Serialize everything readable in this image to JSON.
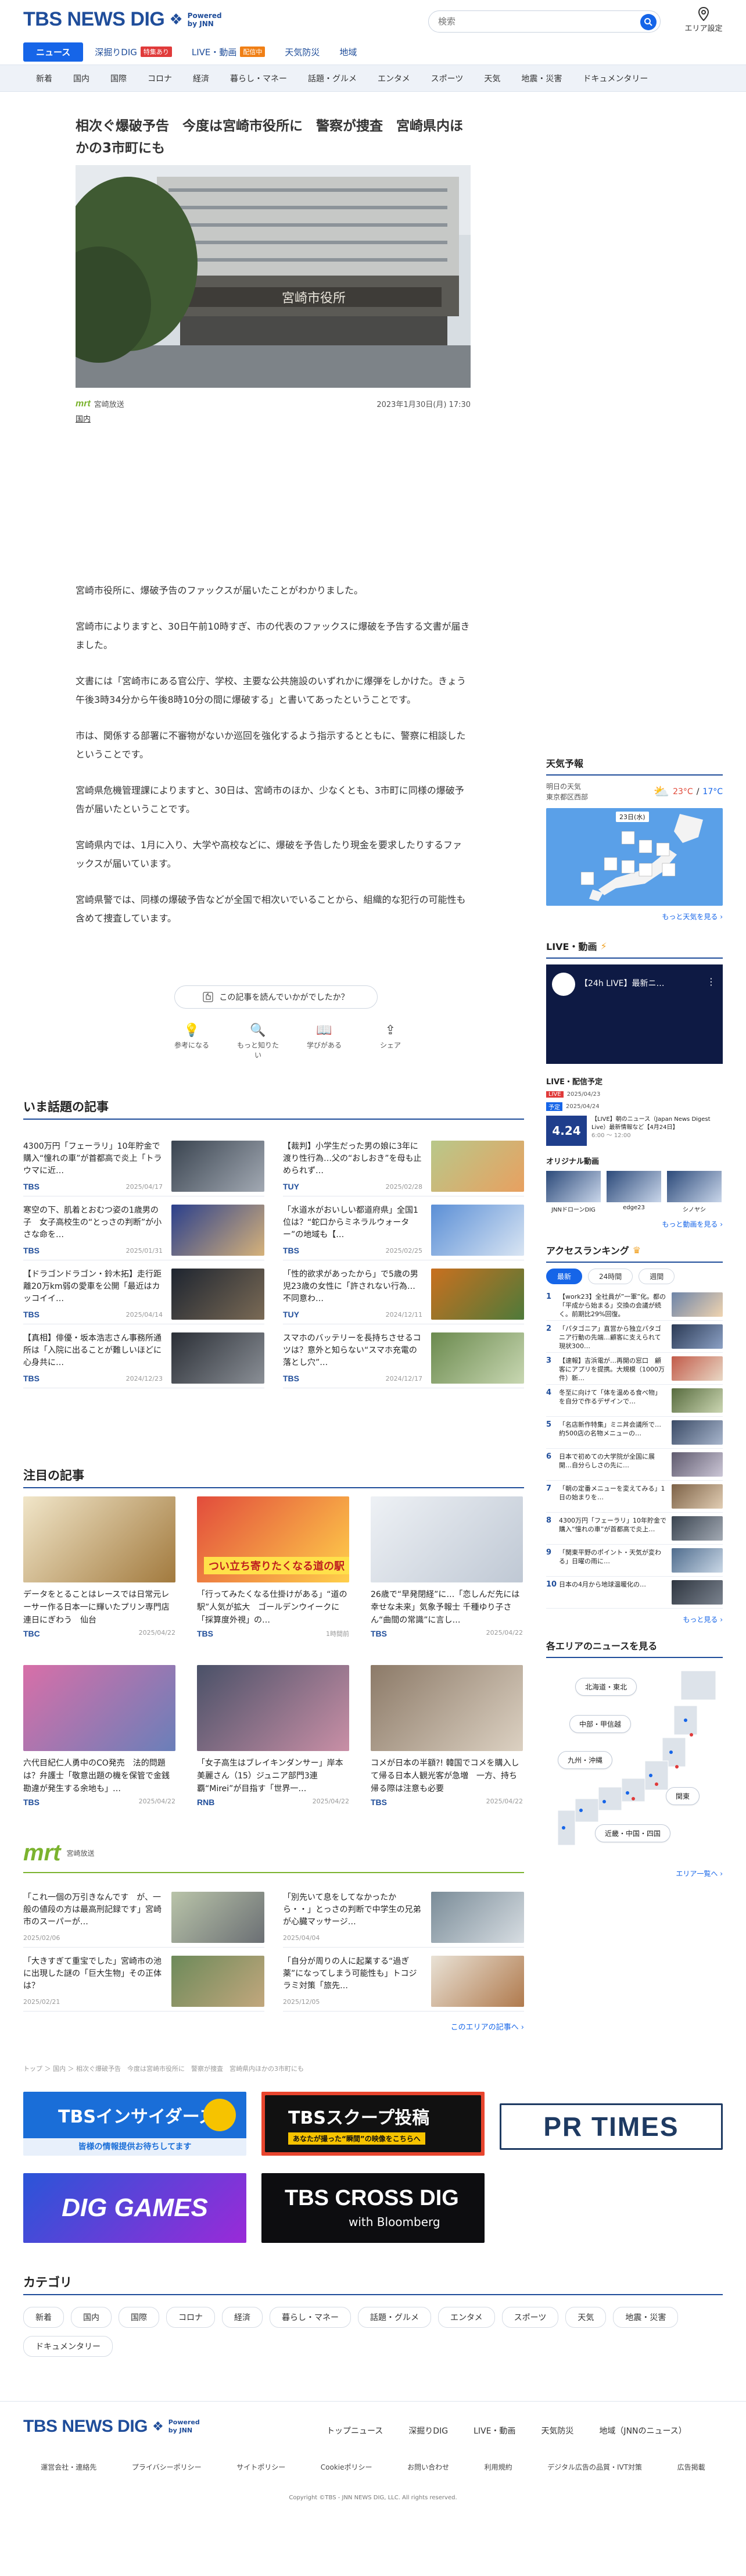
{
  "header": {
    "logo_main": "TBS NEWS DIG",
    "logo_sub_1": "Powered",
    "logo_sub_2": "by JNN",
    "search_placeholder": "検索",
    "area_setting": "エリア設定",
    "nav": [
      {
        "label": "ニュース"
      },
      {
        "label": "深掘りDIG",
        "badge": "特集あり",
        "badge_color": "#e03a3a"
      },
      {
        "label": "LIVE・動画",
        "badge": "配信中",
        "badge_color": "#f07f15"
      },
      {
        "label": "天気防災"
      },
      {
        "label": "地域"
      }
    ],
    "subnav": [
      "新着",
      "国内",
      "国際",
      "コロナ",
      "経済",
      "暮らし・マネー",
      "話題・グルメ",
      "エンタメ",
      "スポーツ",
      "天気",
      "地震・災害",
      "ドキュメンタリー"
    ]
  },
  "article": {
    "title": "相次ぐ爆破予告　今度は宮崎市役所に　警察が捜査　宮崎県内ほかの3市町にも",
    "hero_sign": "宮崎市役所",
    "source": "宮崎放送",
    "source_logo": "mrt",
    "datetime": "2023年1月30日(月) 17:30",
    "category": "国内",
    "paragraphs": [
      "宮崎市役所に、爆破予告のファックスが届いたことがわかりました。",
      "宮崎市によりますと、30日午前10時すぎ、市の代表のファックスに爆破を予告する文書が届きました。",
      "文書には「宮崎市にある官公庁、学校、主要な公共施設のいずれかに爆弾をしかけた。きょう午後3時34分から午後8時10分の間に爆破する」と書いてあったということです。",
      "市は、関係する部署に不審物がないか巡回を強化するよう指示するとともに、警察に相談したということです。",
      "宮崎県危機管理課によりますと、30日は、宮崎市のほか、少なくとも、3市町に同様の爆破予告が届いたということです。",
      "宮崎県内では、1月に入り、大学や高校などに、爆破を予告したり現金を要求したりするファックスが届いています。",
      "宮崎県警では、同様の爆破予告などが全国で相次いでいることから、組織的な犯行の可能性も含めて捜査しています。"
    ],
    "feedback": "この記事を読んでいかがでしたか？",
    "reactions": [
      "参考になる",
      "もっと知りたい",
      "学びがある",
      "シェア"
    ]
  },
  "topics": {
    "title": "いま話題の記事",
    "items": [
      {
        "text": "4300万円「フェーラリ」10年貯金で購入“憧れの車”が首都高で炎上「トラウマに近…",
        "source": "TBS",
        "date": "2025/04/17",
        "c1": "#3a4450",
        "c2": "#a2a9b3"
      },
      {
        "text": "【裁判】小学生だった男の娘に3年に渡り性行為…父の“おしおき”を母も止められず…",
        "source": "TUY",
        "date": "2025/02/28",
        "c1": "#b8c88a",
        "c2": "#e8a060"
      },
      {
        "text": "寒空の下、肌着とおむつ姿の1歳男の子　女子高校生の“とっさの判断”が小さな命を…",
        "source": "TBS",
        "date": "2025/01/31",
        "c1": "#2a3f8c",
        "c2": "#d6b27a"
      },
      {
        "text": "「水道水がおいしい都道府県」全国1位は？“蛇口からミネラルウォーター”の地域も【…",
        "source": "TBS",
        "date": "2025/02/25",
        "c1": "#5b8fd6",
        "c2": "#d9e5f3"
      },
      {
        "text": "【ドラゴンドラゴン・鈴木拓】走行距離20万km弱の愛車を公開「最近はカッコイイ…",
        "source": "TBS",
        "date": "2025/04/14",
        "c1": "#1e2530",
        "c2": "#7a6a55"
      },
      {
        "text": "「性的欲求があったから」で5歳の男児23歳の女性に「許されない行為…不同意わ…",
        "source": "TUY",
        "date": "2024/12/11",
        "c1": "#c9701f",
        "c2": "#4e7a3a"
      },
      {
        "text": "【真相】俳優・坂本浩志さん事務所通所は「入院に出ることが難しいほどに心身共に…",
        "source": "TBS",
        "date": "2024/12/23",
        "c1": "#2b2f36",
        "c2": "#8a8f96"
      },
      {
        "text": "スマホのバッテリーを長持ちさせるコツは？意外と知らない“スマホ充電の落とし穴”…",
        "source": "TBS",
        "date": "2024/12/17",
        "c1": "#6b8a4e",
        "c2": "#c8d7b2"
      }
    ]
  },
  "attention": {
    "title": "注目の記事",
    "items": [
      {
        "text": "データをとることはレースでは日常元レーサー作る日本一に輝いたプリン専門店　連日にぎわう　仙台",
        "source": "TBC",
        "date": "2025/04/22",
        "c1": "#f1e6c9",
        "c2": "#a27a3e"
      },
      {
        "text": "「行ってみたくなる仕掛けがある」“道の駅”人気が拡大　ゴールデンウイークに「採算度外視」の…",
        "source": "TBS",
        "date": "1時間前",
        "c1": "#e24c3c",
        "c2": "#ffd04a",
        "overlay": "つい立ち寄りたくなる道の駅"
      },
      {
        "text": "26歳で“早発閉経”に…「恋しんだ先には幸せな未来」気象予報士 千種ゆり子さん“曲間の常識”に言し…",
        "source": "TBS",
        "date": "2025/04/22",
        "c1": "#eef1f5",
        "c2": "#bfc8d4"
      },
      {
        "text": "六代目紀仁人勇中のCO発売　法的問題は？弁護士「敬意出題の機を保管で金銭勘違が発生する余地も」…",
        "source": "TBS",
        "date": "2025/04/22",
        "c1": "#d86fa8",
        "c2": "#6a7fb9"
      },
      {
        "text": "「女子高生はブレイキンダンサー」岸本美麗さん（15）ジュニア部門3連覇“Mirei”が目指す「世界一…",
        "source": "RNB",
        "date": "2025/04/22",
        "c1": "#4a5168",
        "c2": "#c98fa6"
      },
      {
        "text": "コメが日本の半額?! 韓国でコメを購入して帰る日本人観光客が急増　一方、持ち帰る際は注意も必要",
        "source": "TBS",
        "date": "2025/04/22",
        "c1": "#8c7a68",
        "c2": "#dcd1c2"
      }
    ]
  },
  "local": {
    "logo": "mrt",
    "name": "宮崎放送",
    "items": [
      {
        "text": "「これ一個の万引きなんです　が、一般の値段の方は最高刑記録です」宮崎市のスーパーが…",
        "date": "2025/02/06",
        "c1": "#b9c4a9",
        "c2": "#6b6f74"
      },
      {
        "text": "「別先いて息をしてなかったから・・」とっさの判断で中学生の兄弟が心臓マッサージ…",
        "date": "2025/04/04",
        "c1": "#7a8c98",
        "c2": "#d7dde2"
      },
      {
        "text": "「大きすぎて重宝でした」宮崎市の池に出現した謎の「巨大生物」その正体は？",
        "date": "2025/02/21",
        "c1": "#6d8a5a",
        "c2": "#c2a77d"
      },
      {
        "text": "「自分が周りの人に起業する“過ぎ薬”になってしまう可能性も」トコジラミ対策「旅先…",
        "date": "2025/12/05",
        "c1": "#e9e2d6",
        "c2": "#b07a4d"
      }
    ],
    "more": "このエリアの記事へ ›"
  },
  "breadcrumb": "トップ ＞ 国内 ＞ 相次ぐ爆破予告　今度は宮崎市役所に　警察が捜査　宮崎県内ほかの3市町にも",
  "banners": {
    "insider_main": "TBSインサイダーズ",
    "insider_sub": "皆様の情報提供お待ちしてます",
    "scoop_main": "TBSスクープ投稿",
    "scoop_sub": "あなたが撮った“瞬間”の映像をこちらへ",
    "prtimes": "PR TIMES",
    "digagames": "DIG GAMES",
    "crossdig_main": "TBS CROSS DIG",
    "crossdig_sub": "with Bloomberg"
  },
  "categories": {
    "title": "カテゴリ",
    "items": [
      "新着",
      "国内",
      "国際",
      "コロナ",
      "経済",
      "暮らし・マネー",
      "話題・グルメ",
      "エンタメ",
      "スポーツ",
      "天気",
      "地震・災害",
      "ドキュメンタリー"
    ]
  },
  "sidebar": {
    "weather": {
      "title": "天気予報",
      "label": "明日の天気",
      "region": "東京都区西部",
      "hi": "23°C",
      "lo": "17°C",
      "day_label": "23日(水)",
      "more": "もっと天気を見る ›"
    },
    "live": {
      "title": "LIVE・動画",
      "video_title": "【24h LIVE】最新ニ…",
      "schedule_title": "LIVE・配信予定",
      "sched_date": "2025/04/23",
      "sched_date2": "2025/04/24",
      "sched_badge": "4.24",
      "sched_text": "【LIVE】朝のニュース（Japan News Digest Live）最新情報など【4月24日】",
      "sched_time": "6:00 ～ 12:00",
      "original_title": "オリジナル動画",
      "originals": [
        "JNNドローンDIG",
        "edge23",
        "シノヤシ"
      ],
      "more": "もっと動画を見る ›"
    },
    "ranking": {
      "title": "アクセスランキング",
      "tabs": [
        "最新",
        "24時間",
        "週間"
      ],
      "items": [
        {
          "n": "1",
          "text": "【work23】全社員が”一軍”化。都の「平成から始まる」交換の会議が続く。前期比29%回復。",
          "c1": "#6d84a8",
          "c2": "#f0d4b0"
        },
        {
          "n": "2",
          "text": "「パタゴニア」直営から独立パタゴニア行動の先端…顧客に支えられて現状300…",
          "c1": "#2b3a55",
          "c2": "#8ba0c4"
        },
        {
          "n": "3",
          "text": "【速報】吉浜電が…再開の窓口　顧客にアプリを提携。大規模（1000万件）新…",
          "c1": "#c25b4a",
          "c2": "#e9d8c5"
        },
        {
          "n": "4",
          "text": "冬至に向けて「体を温める食べ物」を自分で作るデザインで…",
          "c1": "#576b3e",
          "c2": "#cbd6b2"
        },
        {
          "n": "5",
          "text": "「名店新作特集」ミニ丼会議所で…約500店の名物メニューの…",
          "c1": "#3b4b66",
          "c2": "#a7b5cc"
        },
        {
          "n": "6",
          "text": "日本で初めての大学院が全国に展開…自分らしさの先に…",
          "c1": "#5f5a6e",
          "c2": "#cbc6d6"
        },
        {
          "n": "7",
          "text": "「朝の定番メニューを変えてみる」1日の始まりを…",
          "c1": "#7d6247",
          "c2": "#e1cdb3"
        },
        {
          "n": "8",
          "text": "4300万円「フェーラリ」10年貯金で購入“憧れの車”が首都高で炎上…",
          "c1": "#3a4450",
          "c2": "#a2a9b3"
        },
        {
          "n": "9",
          "text": "「関東平野のポイント・天気が変わる」日曜の雨に…",
          "c1": "#4f6c8d",
          "c2": "#c9d7e6"
        },
        {
          "n": "10",
          "text": "日本の4月から地球温暖化の…",
          "c1": "#2f3640",
          "c2": "#7a828e"
        }
      ],
      "more": "もっと見る ›"
    },
    "areas": {
      "title": "各エリアのニュースを見る",
      "buttons": [
        "北海道・東北",
        "中部・甲信越",
        "九州・沖縄",
        "関東",
        "近畿・中国・四国"
      ],
      "more": "エリア一覧へ ›"
    }
  },
  "footer": {
    "logo_main": "TBS NEWS DIG",
    "logo_sub_1": "Powered",
    "logo_sub_2": "by JNN",
    "nav": [
      "トップニュース",
      "深掘りDIG",
      "LIVE・動画",
      "天気防災",
      "地域（JNNのニュース）"
    ],
    "links": [
      "運営会社・連絡先",
      "プライバシーポリシー",
      "サイトポリシー",
      "Cookieポリシー",
      "お問い合わせ",
      "利用規約",
      "デジタル広告の品質・IVT対策",
      "広告掲載"
    ],
    "copyright": "Copyright ©TBS - JNN NEWS DIG, LLC. All rights reserved."
  }
}
